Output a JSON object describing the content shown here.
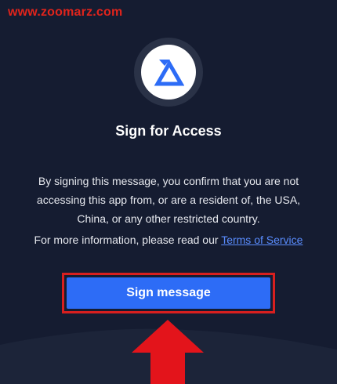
{
  "watermark": "www.zoomarz.com",
  "dialog": {
    "logo_icon": "delta-triangle-icon",
    "title": "Sign for Access",
    "message": "By signing this message, you confirm that you are not accessing this app from, or are a resident of, the USA, China, or any other restricted country.",
    "info_prefix": "For more information, please read our ",
    "tos_link": "Terms of Service",
    "sign_button_label": "Sign message"
  },
  "annotation": {
    "arrow_icon": "up-arrow-icon",
    "highlight_color": "#d81f1f"
  },
  "colors": {
    "background": "#151c31",
    "button": "#2d6cf6",
    "link": "#5a8dff"
  }
}
